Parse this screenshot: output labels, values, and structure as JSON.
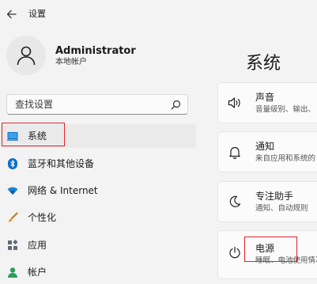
{
  "window": {
    "title": "设置"
  },
  "account": {
    "name": "Administrator",
    "type": "本地帐户"
  },
  "search": {
    "placeholder": "查找设置"
  },
  "sidebar": {
    "items": [
      {
        "label": "系统",
        "icon": "system-icon",
        "selected": true
      },
      {
        "label": "蓝牙和其他设备",
        "icon": "bluetooth-icon",
        "selected": false
      },
      {
        "label": "网络 & Internet",
        "icon": "network-icon",
        "selected": false
      },
      {
        "label": "个性化",
        "icon": "brush-icon",
        "selected": false
      },
      {
        "label": "应用",
        "icon": "apps-icon",
        "selected": false
      },
      {
        "label": "帐户",
        "icon": "account-icon",
        "selected": false
      }
    ]
  },
  "main": {
    "title": "系统",
    "cards": [
      {
        "title": "声音",
        "subtitle": "音量级别、输出、",
        "icon": "speaker-icon"
      },
      {
        "title": "通知",
        "subtitle": "来自应用和系统的",
        "icon": "bell-icon"
      },
      {
        "title": "专注助手",
        "subtitle": "通知、自动规则",
        "icon": "moon-icon"
      },
      {
        "title": "电源",
        "subtitle": "睡眠、电池使用情况",
        "icon": "power-icon"
      }
    ]
  },
  "colors": {
    "accent": "#0067c0",
    "highlight": "#e0222b",
    "background": "#f3f3f3"
  }
}
